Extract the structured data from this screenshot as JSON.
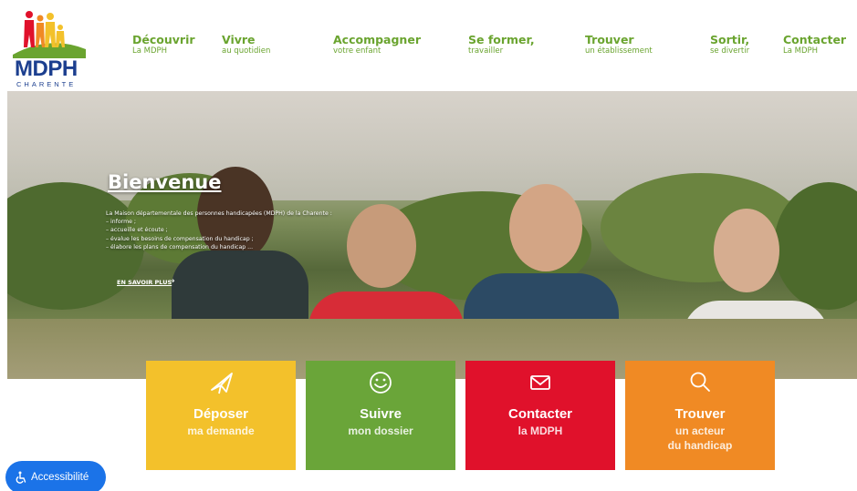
{
  "logo": {
    "text": "MDPH",
    "subtitle": "CHARENTE"
  },
  "nav": [
    {
      "title": "Découvrir",
      "sub": "La MDPH"
    },
    {
      "title": "Vivre",
      "sub": "au quotidien"
    },
    {
      "title": "Accompagner",
      "sub": "votre enfant"
    },
    {
      "title": "Se former,",
      "sub": "travailler"
    },
    {
      "title": "Trouver",
      "sub": "un établissement"
    },
    {
      "title": "Sortir,",
      "sub": "se divertir"
    },
    {
      "title": "Contacter",
      "sub": "La MDPH"
    }
  ],
  "hero": {
    "title": "Bienvenue",
    "lines": [
      "La Maison départementale des personnes handicapées (MDPH) de la Charente :",
      "– informe ;",
      "– accueille et écoute ;",
      "– évalue les besoins de compensation du handicap ;",
      "– élabore les plans de compensation du handicap ..."
    ],
    "link": "EN SAVOIR PLUS",
    "link_arrow": "→"
  },
  "tiles": [
    {
      "title": "Déposer",
      "sub1": "ma demande",
      "sub2": "",
      "color": "#f3c12b",
      "icon": "paper-plane-icon"
    },
    {
      "title": "Suivre",
      "sub1": "mon dossier",
      "sub2": "",
      "color": "#6aa539",
      "icon": "smiley-icon"
    },
    {
      "title": "Contacter",
      "sub1": "la MDPH",
      "sub2": "",
      "color": "#e0112b",
      "icon": "envelope-icon"
    },
    {
      "title": "Trouver",
      "sub1": "un acteur",
      "sub2": "du handicap",
      "color": "#f08a24",
      "icon": "search-icon"
    }
  ],
  "accessibility": {
    "label": "Accessibilité"
  },
  "colors": {
    "nav_green": "#6aa42f",
    "logo_blue": "#1c3f8f",
    "a11y_blue": "#1b73e8"
  }
}
